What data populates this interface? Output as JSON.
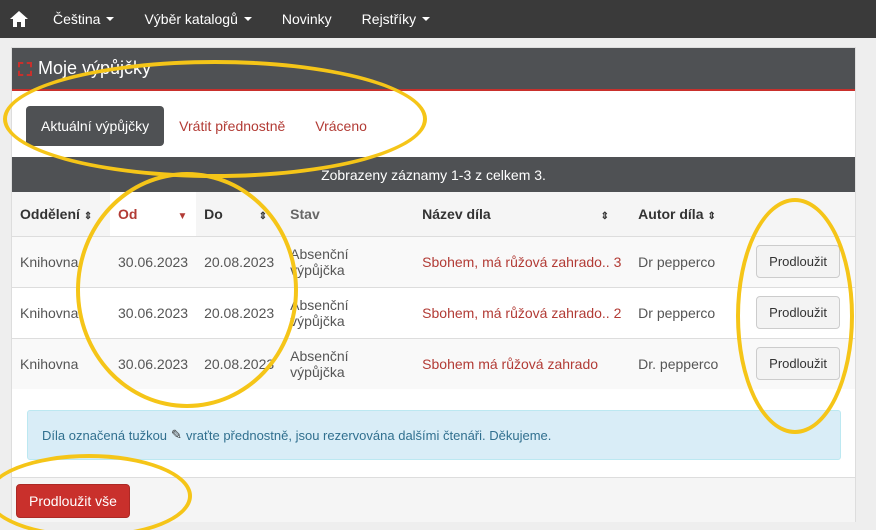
{
  "navbar": {
    "items": [
      {
        "label": "Čeština",
        "dropdown": true
      },
      {
        "label": "Výběr katalogů",
        "dropdown": true
      },
      {
        "label": "Novinky",
        "dropdown": false
      },
      {
        "label": "Rejstříky",
        "dropdown": true
      }
    ]
  },
  "panel": {
    "title": "Moje výpůjčky",
    "tabs": [
      "Aktuální výpůjčky",
      "Vrátit přednostně",
      "Vráceno"
    ],
    "info": "Zobrazeny záznamy 1-3 z celkem 3."
  },
  "table": {
    "headers": [
      "Oddělení",
      "Od",
      "Do",
      "Stav",
      "Název díla",
      "Autor díla",
      ""
    ],
    "rows": [
      {
        "dept": "Knihovna",
        "from": "30.06.2023",
        "to": "20.08.2023",
        "status": "Absenční výpůjčka",
        "title": "Sbohem, má růžová zahrado.. 3",
        "author": "Dr pepperco",
        "action": "Prodloužit"
      },
      {
        "dept": "Knihovna",
        "from": "30.06.2023",
        "to": "20.08.2023",
        "status": "Absenční výpůjčka",
        "title": "Sbohem, má růžová zahrado.. 2",
        "author": "Dr pepperco",
        "action": "Prodloužit"
      },
      {
        "dept": "Knihovna",
        "from": "30.06.2023",
        "to": "20.08.2023",
        "status": "Absenční výpůjčka",
        "title": "Sbohem má růžová zahrado",
        "author": "Dr. pepperco",
        "action": "Prodloužit"
      }
    ]
  },
  "alert": {
    "before": "Díla označená tužkou",
    "after": "vraťte přednostně, jsou rezervována dalšími čtenáři. Děkujeme."
  },
  "footer": {
    "renew_all": "Prodloužit vše"
  },
  "colors": {
    "accent": "#b23b35",
    "navbar": "#3a3a3a",
    "panel_header": "#4f5154",
    "annotation": "#f5c518"
  }
}
